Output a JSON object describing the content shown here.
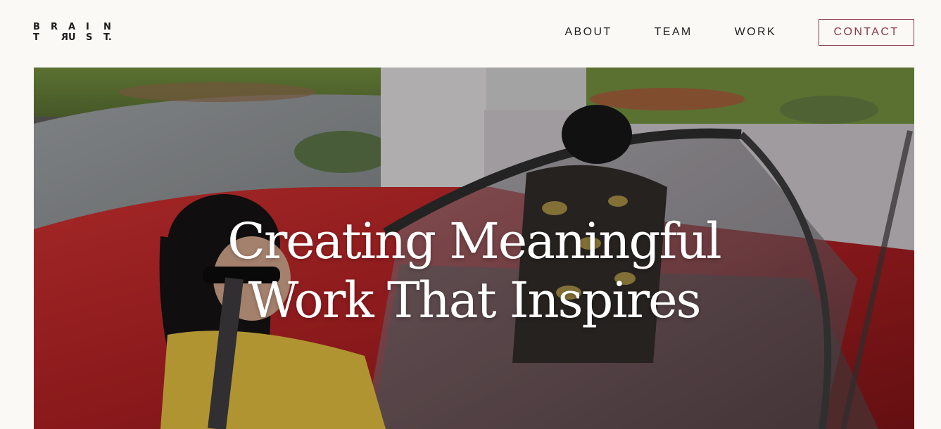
{
  "logo": {
    "row1": [
      "B",
      "R",
      "A",
      "I",
      "N"
    ],
    "row2": [
      "T",
      "R",
      "U",
      "S",
      "T."
    ]
  },
  "nav": {
    "items": [
      "ABOUT",
      "TEAM",
      "WORK"
    ],
    "contact_label": "CONTACT"
  },
  "hero": {
    "headline_line1": "Creating Meaningful",
    "headline_line2": "Work That Inspires"
  },
  "colors": {
    "background": "#fbf9f5",
    "accent": "#8a3a4a",
    "car_red": "#b3262a"
  }
}
